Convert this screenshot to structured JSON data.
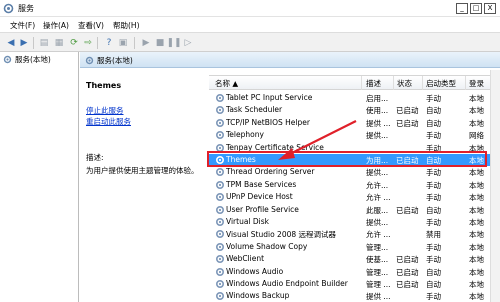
{
  "window": {
    "title": "服务",
    "buttons": {
      "minimize": "_",
      "maximize": "□",
      "close": "X"
    }
  },
  "menu": [
    "文件(F)",
    "操作(A)",
    "查看(V)",
    "帮助(H)"
  ],
  "tree": {
    "item": "服务(本地)"
  },
  "panel": {
    "header": "服务(本地)"
  },
  "details": {
    "name": "Themes",
    "stop_link": "停止此服务",
    "restart_link": "重启动此服务",
    "desc_label": "描述:",
    "desc_text": "为用户提供使用主题管理的体验。"
  },
  "columns": {
    "name": "名称",
    "desc": "描述",
    "status": "状态",
    "startup": "启动类型",
    "logon": "登录"
  },
  "rows": [
    {
      "name": "Tablet PC Input Service",
      "desc": "启用...",
      "status": "",
      "startup": "手动",
      "logon": "本地"
    },
    {
      "name": "Task Scheduler",
      "desc": "使用...",
      "status": "已启动",
      "startup": "自动",
      "logon": "本地"
    },
    {
      "name": "TCP/IP NetBIOS Helper",
      "desc": "提供 ...",
      "status": "已启动",
      "startup": "自动",
      "logon": "本地"
    },
    {
      "name": "Telephony",
      "desc": "提供...",
      "status": "",
      "startup": "手动",
      "logon": "网络"
    },
    {
      "name": "Tenpay Certificate Service",
      "desc": "",
      "status": "",
      "startup": "手动",
      "logon": "本地"
    },
    {
      "name": "Themes",
      "desc": "为用...",
      "status": "已启动",
      "startup": "自动",
      "logon": "本地",
      "selected": true
    },
    {
      "name": "Thread Ordering Server",
      "desc": "提供...",
      "status": "",
      "startup": "手动",
      "logon": "本地"
    },
    {
      "name": "TPM Base Services",
      "desc": "允许...",
      "status": "",
      "startup": "手动",
      "logon": "本地"
    },
    {
      "name": "UPnP Device Host",
      "desc": "允许 ...",
      "status": "",
      "startup": "手动",
      "logon": "本地"
    },
    {
      "name": "User Profile Service",
      "desc": "此服...",
      "status": "已启动",
      "startup": "自动",
      "logon": "本地"
    },
    {
      "name": "Virtual Disk",
      "desc": "提供...",
      "status": "",
      "startup": "手动",
      "logon": "本地"
    },
    {
      "name": "Visual Studio 2008 远程调试器",
      "desc": "允许 ...",
      "status": "",
      "startup": "禁用",
      "logon": "本地"
    },
    {
      "name": "Volume Shadow Copy",
      "desc": "管理...",
      "status": "",
      "startup": "手动",
      "logon": "本地"
    },
    {
      "name": "WebClient",
      "desc": "使基...",
      "status": "已启动",
      "startup": "手动",
      "logon": "本地"
    },
    {
      "name": "Windows Audio",
      "desc": "管理...",
      "status": "已启动",
      "startup": "自动",
      "logon": "本地"
    },
    {
      "name": "Windows Audio Endpoint Builder",
      "desc": "管理 ...",
      "status": "已启动",
      "startup": "自动",
      "logon": "本地"
    },
    {
      "name": "Windows Backup",
      "desc": "提供 ...",
      "status": "",
      "startup": "手动",
      "logon": "本地"
    }
  ],
  "colors": {
    "selection": "#3399ff",
    "highlight_box": "#e0202a",
    "link": "#0033cc"
  }
}
